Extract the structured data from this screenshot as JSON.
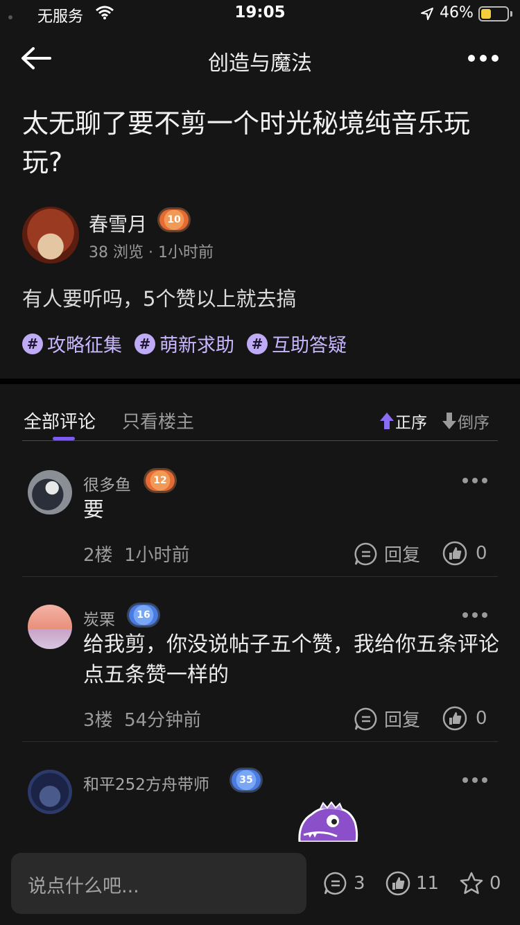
{
  "status_bar": {
    "carrier": "无服务",
    "time": "19:05",
    "battery": "46%"
  },
  "nav": {
    "title": "创造与魔法"
  },
  "post": {
    "title": "太无聊了要不剪一个时光秘境纯音乐玩玩?",
    "author": {
      "name": "春雪月",
      "level": "10",
      "meta": "38 浏览 · 1小时前"
    },
    "body": "有人要听吗，5个赞以上就去搞",
    "tags": [
      "攻略征集",
      "萌新求助",
      "互助答疑"
    ]
  },
  "comment_tabs": {
    "all": "全部评论",
    "owner_only": "只看楼主",
    "asc": "正序",
    "desc": "倒序"
  },
  "comments": [
    {
      "name": "很多鱼",
      "level": "12",
      "text": "要",
      "floor": "2楼",
      "time": "1小时前",
      "reply": "回复",
      "likes": "0"
    },
    {
      "name": "炭栗",
      "level": "16",
      "text": "给我剪，你没说帖子五个赞，我给你五条评论点五条赞一样的",
      "floor": "3楼",
      "time": "54分钟前",
      "reply": "回复",
      "likes": "0"
    },
    {
      "name": "和平252方舟带师",
      "level": "35"
    }
  ],
  "bottom_bar": {
    "placeholder": "说点什么吧...",
    "comments": "3",
    "likes": "11",
    "favorites": "0"
  },
  "colors": {
    "accent": "#7c5cf0",
    "tag": "#c9b6ff",
    "background": "#151515"
  }
}
